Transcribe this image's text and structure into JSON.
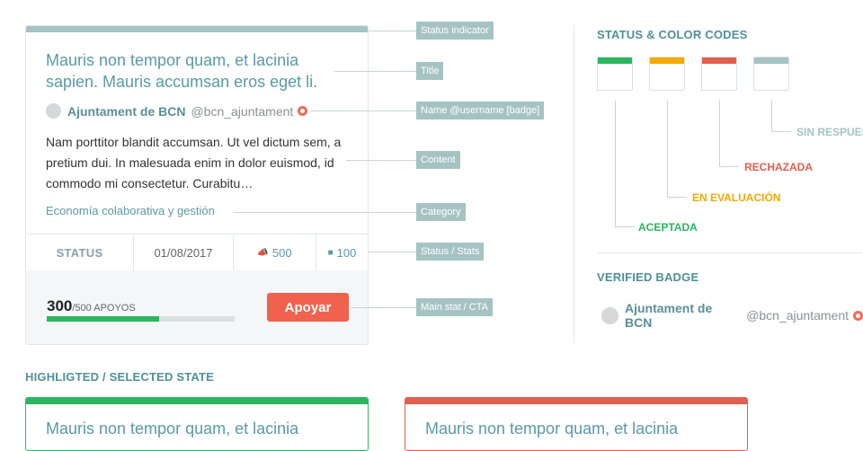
{
  "card": {
    "title": "Mauris non tempor quam, et lacinia sapien. Mauris accumsan eros eget li.",
    "author_name": "Ajuntament de BCN",
    "author_username": "@bcn_ajuntament",
    "content": "Nam porttitor blandit accumsan. Ut vel dictum sem, a pretium dui. In malesuada enim in dolor euismod, id commodo mi consectetur. Curabitu…",
    "category": "Economía colaborativa y gestión",
    "status_label": "STATUS",
    "date": "01/08/2017",
    "votes_count": "500",
    "comments_count": "100",
    "supports_current": "300",
    "supports_rest": "/500 APOYOS",
    "supports_progress": 0.6,
    "cta_label": "Apoyar"
  },
  "annotations": {
    "status_indicator": "Status indicator",
    "title": "Title",
    "name": "Name @username [badge]",
    "content": "Content",
    "category": "Category",
    "stats": "Status / Stats",
    "main_stat": "Main stat / CTA"
  },
  "status_codes": {
    "heading": "STATUS & COLOR CODES",
    "items": [
      {
        "label": "ACEPTADA",
        "color": "#2bb560"
      },
      {
        "label": "EN EVALUACIÓN",
        "color": "#f2a900"
      },
      {
        "label": "RECHAZADA",
        "color": "#e05f4e"
      },
      {
        "label": "SIN RESPUESTA",
        "color": "#a6c3c3"
      }
    ]
  },
  "verified": {
    "heading": "VERIFIED BADGE",
    "name": "Ajuntament de BCN",
    "username": "@bcn_ajuntament"
  },
  "highlight": {
    "heading": "HIGHLIGTED / SELECTED STATE",
    "card_title": "Mauris non tempor quam, et lacinia",
    "colors": [
      "#2bb560",
      "#e05f4e"
    ]
  },
  "colors": {
    "accent": "#5a9aa8",
    "cta": "#f0624e",
    "status_neutral": "#a6c3c3",
    "verified_badge": "#ef6a58"
  }
}
